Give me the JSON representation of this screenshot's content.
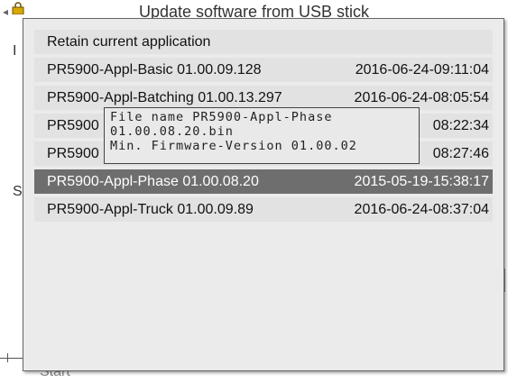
{
  "window": {
    "title": "Update software from USB stick",
    "bottom_button": "Start"
  },
  "dialog": {
    "options": [
      {
        "name": "Retain current application",
        "date": ""
      },
      {
        "name": "PR5900-Appl-Basic 01.00.09.128",
        "date": "2016-06-24-09:11:04"
      },
      {
        "name": "PR5900-Appl-Batching 01.00.13.297",
        "date": "2016-06-24-08:05:54"
      },
      {
        "name": "PR5900",
        "date": "08:22:34"
      },
      {
        "name": "PR5900",
        "date": "08:27:46"
      },
      {
        "name": "PR5900-Appl-Phase 01.00.08.20",
        "date": "2015-05-19-15:38:17",
        "selected": true
      },
      {
        "name": "PR5900-Appl-Truck 01.00.09.89",
        "date": "2016-06-24-08:37:04"
      }
    ]
  },
  "tooltip": {
    "line1": "File name PR5900-Appl-Phase",
    "line2": "01.00.08.20.bin",
    "line3": "Min. Firmware-Version 01.00.02"
  },
  "colors": {
    "selected_bg": "#6e6e6e",
    "row_bg": "#e2e2e2",
    "dialog_bg": "#ebebeb"
  }
}
